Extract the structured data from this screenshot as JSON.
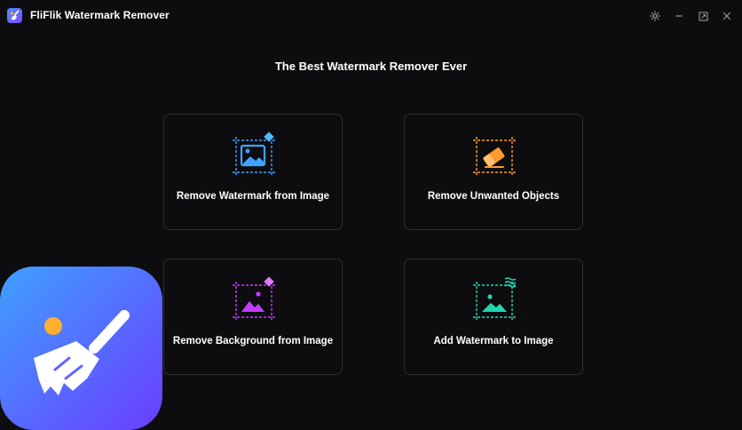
{
  "app": {
    "title": "FliFlik Watermark Remover"
  },
  "window_controls": {
    "settings": "gear-icon",
    "minimize": "minimize-icon",
    "maximize": "maximize-icon",
    "close": "close-icon"
  },
  "main": {
    "headline": "The Best Watermark Remover Ever",
    "cards": [
      {
        "label": "Remove Watermark from Image",
        "icon": "watermark-image-icon",
        "accent": "#3ea2ff"
      },
      {
        "label": "Remove Unwanted Objects",
        "icon": "eraser-icon",
        "accent": "#ff9a2e"
      },
      {
        "label": "Remove Background from Image",
        "icon": "background-image-icon",
        "accent": "#c23cff"
      },
      {
        "label": "Add Watermark to Image",
        "icon": "add-watermark-icon",
        "accent": "#22d6b0"
      }
    ]
  },
  "colors": {
    "background": "#0d0d0f",
    "card_border": "#2e2e33",
    "logo_gradient_start": "#3fa0ff",
    "logo_gradient_end": "#6a3dff",
    "logo_dot": "#ffb02e"
  }
}
